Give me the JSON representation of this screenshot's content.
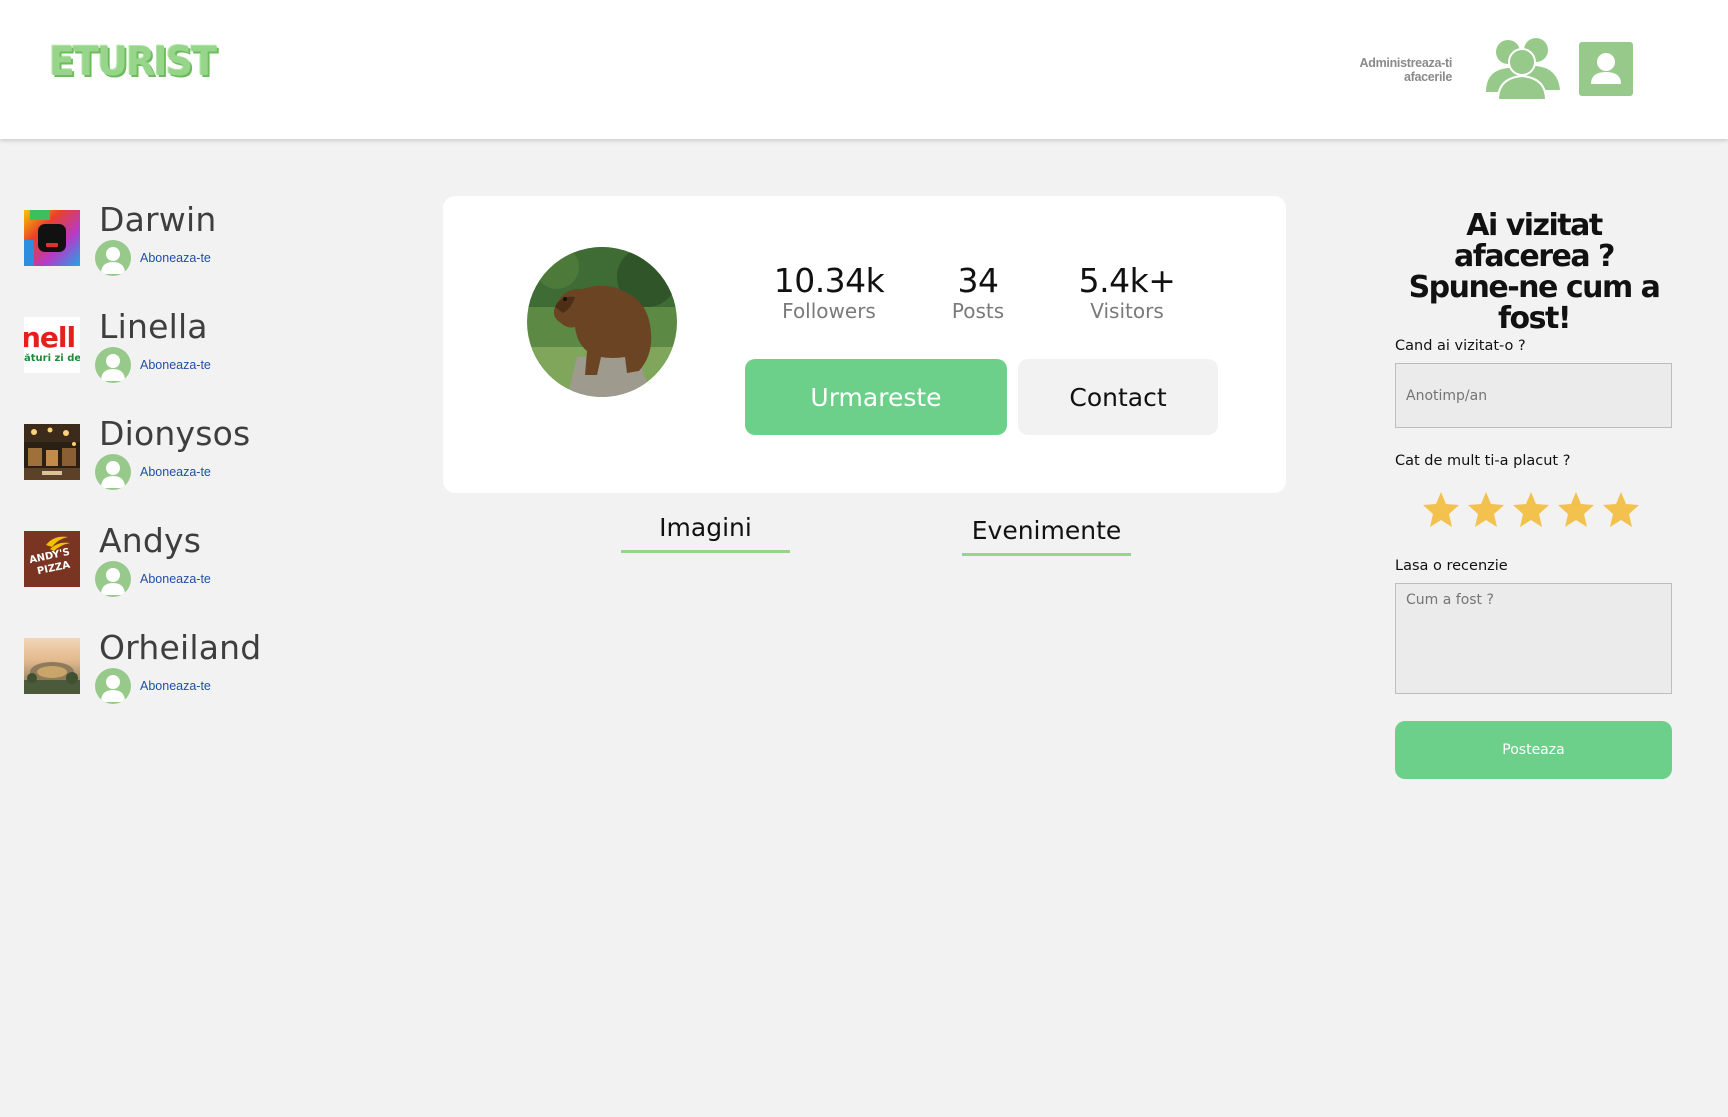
{
  "header": {
    "logo_text": "ETURIST",
    "manage_line1": "Administreaza-ti",
    "manage_line2": "afacerile",
    "group_icon": "users-group-icon",
    "user_icon": "user-account-icon"
  },
  "sidebar": {
    "items": [
      {
        "name": "Darwin",
        "subscribe": "Aboneaza-te",
        "thumb": "darwin-logo"
      },
      {
        "name": "Linella",
        "subscribe": "Aboneaza-te",
        "thumb": "linella-logo"
      },
      {
        "name": "Dionysos",
        "subscribe": "Aboneaza-te",
        "thumb": "dionysos-photo"
      },
      {
        "name": "Andys",
        "subscribe": "Aboneaza-te",
        "thumb": "andys-pizza-logo"
      },
      {
        "name": "Orheiland",
        "subscribe": "Aboneaza-te",
        "thumb": "orheiland-photo"
      }
    ],
    "linella_thumb_text1": "nell",
    "linella_thumb_text2": "ături zi de",
    "andys_thumb_text1": "ANDY'S",
    "andys_thumb_text2": "PIZZA"
  },
  "profile": {
    "avatar": "bear-photo",
    "stats": [
      {
        "value": "10.34k",
        "label": "Followers"
      },
      {
        "value": "34",
        "label": "Posts"
      },
      {
        "value": "5.4k+",
        "label": "Visitors"
      }
    ],
    "follow_label": "Urmareste",
    "contact_label": "Contact"
  },
  "tabs": [
    {
      "label": "Imagini"
    },
    {
      "label": "Evenimente"
    }
  ],
  "review": {
    "title": "Ai vizitat afacerea ? Spune-ne cum a fost!",
    "visit_label": "Cand ai vizitat-o ?",
    "visit_placeholder": "Anotimp/an",
    "rating_label": "Cat de mult ti-a placut ?",
    "rating": 5,
    "rating_max": 5,
    "review_label": "Lasa o recenzie",
    "review_placeholder": "Cum a fost ?",
    "post_label": "Posteaza"
  },
  "colors": {
    "accent_green": "#6dd08a",
    "icon_green": "#97c98b",
    "star_gold": "#f2c14e",
    "link_blue": "#1f4fa8"
  }
}
